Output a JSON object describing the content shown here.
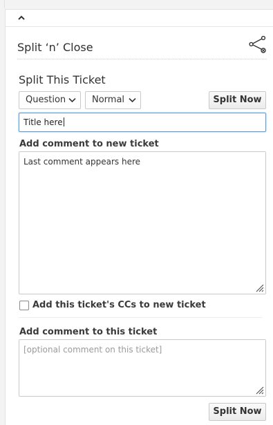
{
  "panel": {
    "title": "Split ‘n’ Close"
  },
  "split_ticket": {
    "section_title": "Split This Ticket",
    "type_select": {
      "selected": "Question"
    },
    "priority_select": {
      "selected": "Normal"
    },
    "split_now_label": "Split Now",
    "title_input": {
      "value": "Title here"
    },
    "new_ticket_comment": {
      "label": "Add comment to new ticket",
      "value": "Last comment appears here"
    },
    "copy_ccs": {
      "label": "Add this ticket's CCs to new ticket",
      "checked": false
    },
    "this_ticket_comment": {
      "label": "Add comment to this ticket",
      "placeholder": "[optional comment on this ticket]"
    },
    "split_now_bottom_label": "Split Now"
  },
  "icons": {
    "collapse": "chevron-up-icon",
    "share": "share-icon",
    "select_arrow": "chevron-down-icon",
    "resize": "resize-grip-icon"
  }
}
